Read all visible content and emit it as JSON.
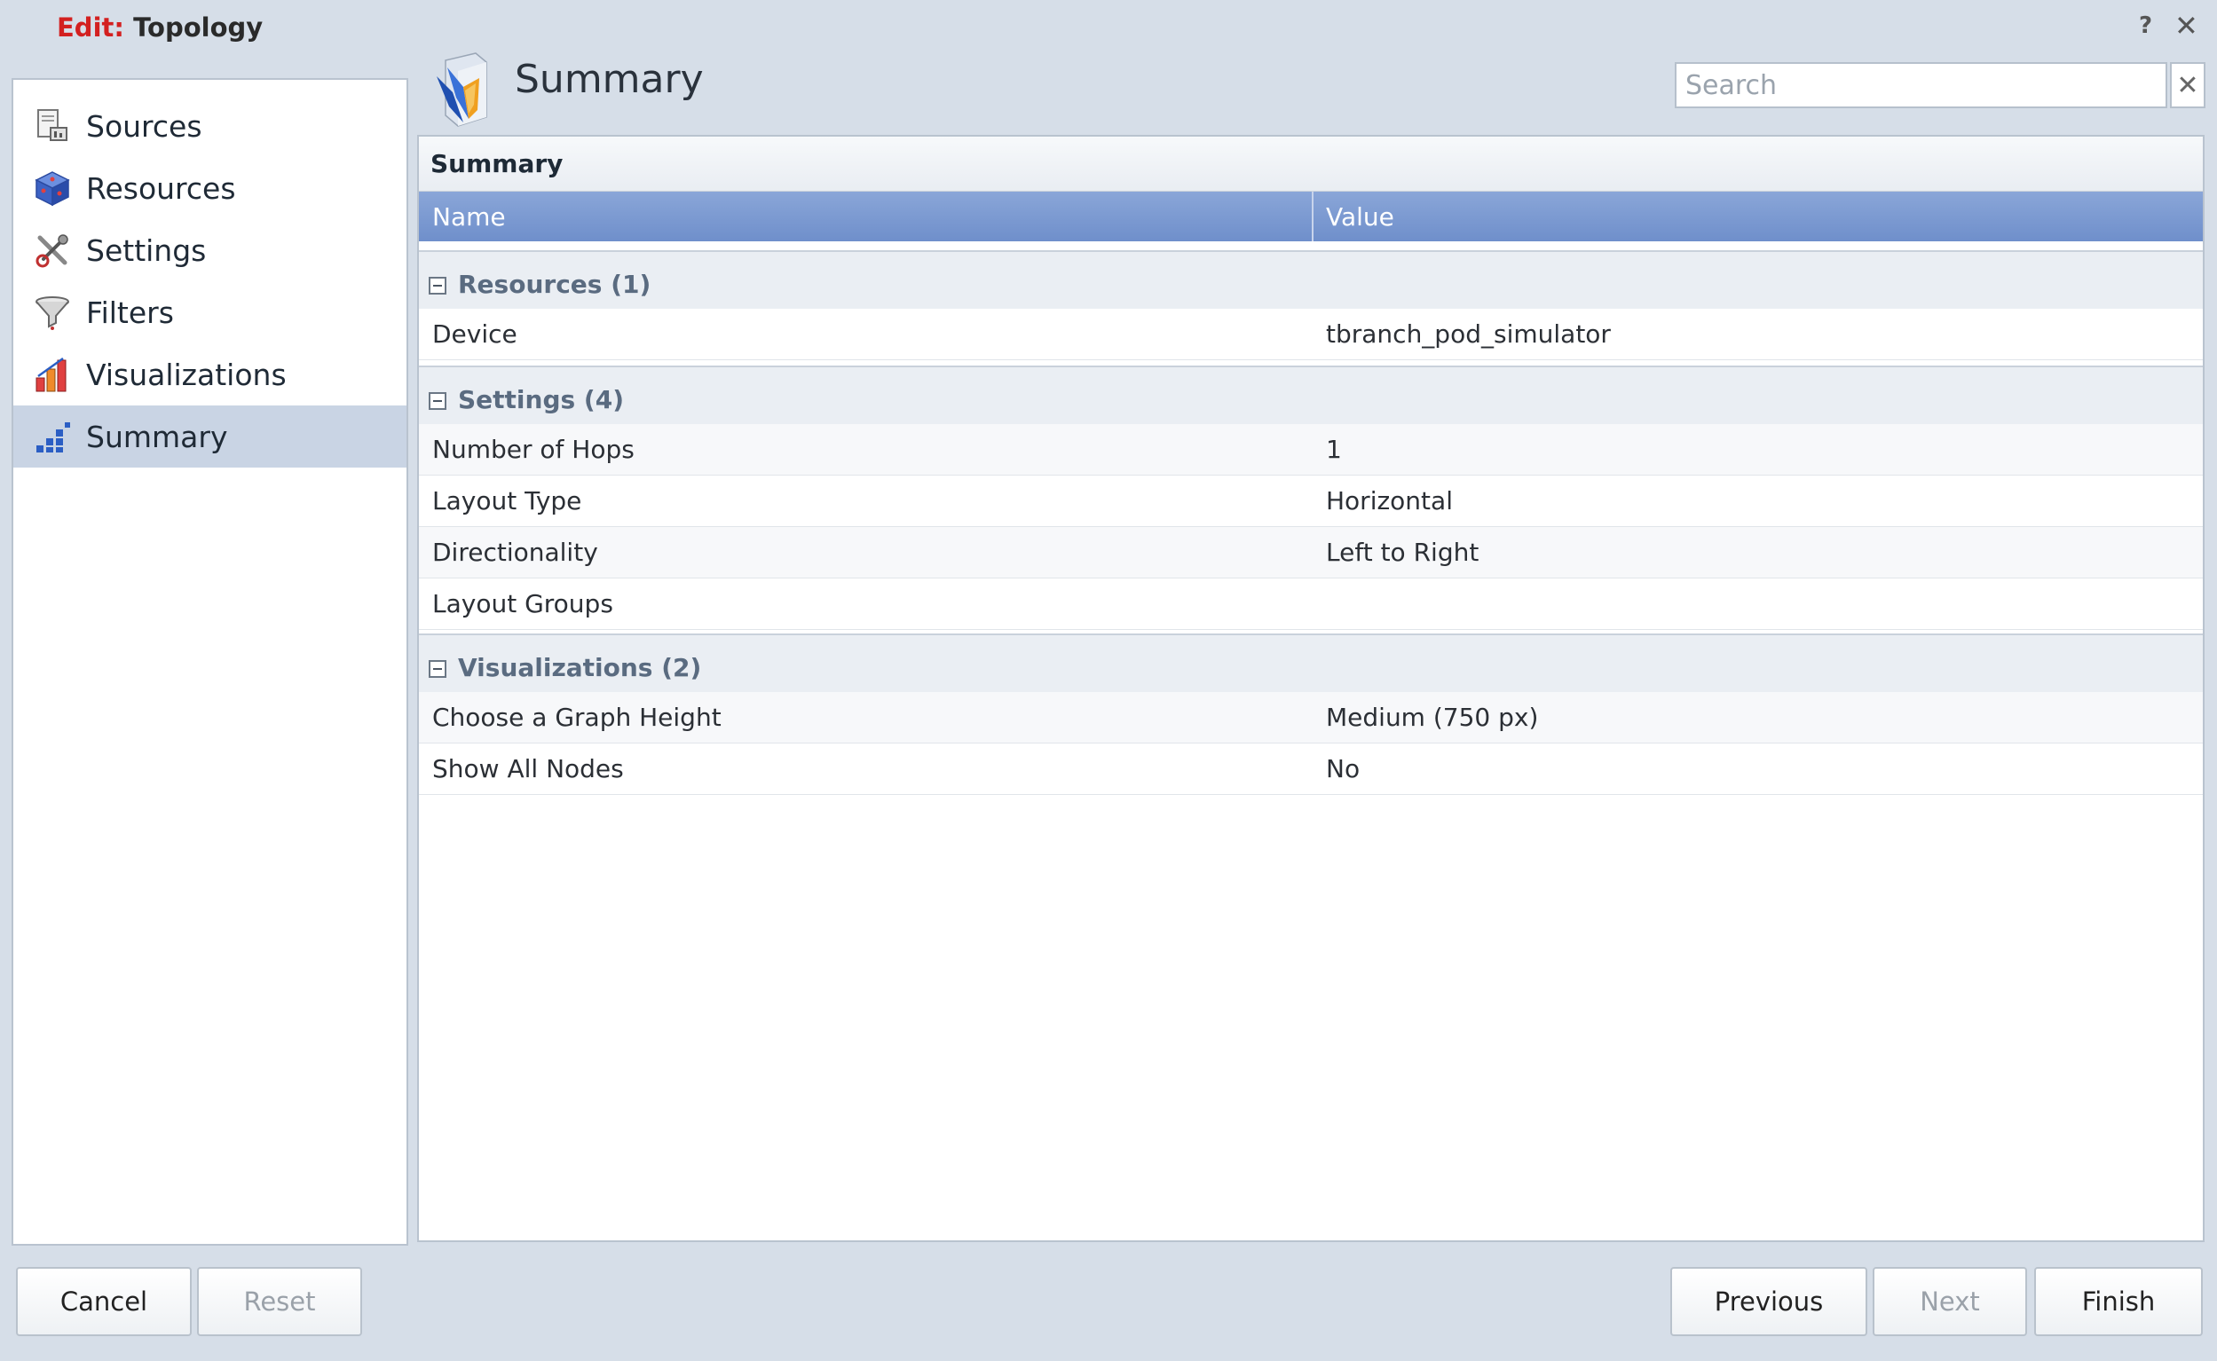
{
  "window": {
    "title_prefix": "Edit:",
    "title_name": "Topology",
    "help_label": "?",
    "close_label": "✕"
  },
  "sidebar": {
    "items": [
      {
        "label": "Sources",
        "icon": "sources-icon",
        "active": false
      },
      {
        "label": "Resources",
        "icon": "resources-cube-icon",
        "active": false
      },
      {
        "label": "Settings",
        "icon": "settings-tools-icon",
        "active": false
      },
      {
        "label": "Filters",
        "icon": "filter-funnel-icon",
        "active": false
      },
      {
        "label": "Visualizations",
        "icon": "bar-chart-icon",
        "active": false
      },
      {
        "label": "Summary",
        "icon": "summary-chart-icon",
        "active": true
      }
    ]
  },
  "header": {
    "title": "Summary",
    "icon": "summary-logo-icon",
    "search_placeholder": "Search",
    "search_value": "",
    "search_clear_label": "✕"
  },
  "panel": {
    "title": "Summary",
    "columns": {
      "name": "Name",
      "value": "Value"
    },
    "groups": [
      {
        "label": "Resources (1)",
        "rows": [
          {
            "name": "Device",
            "value": "tbranch_pod_simulator"
          }
        ]
      },
      {
        "label": "Settings (4)",
        "rows": [
          {
            "name": "Number of Hops",
            "value": "1"
          },
          {
            "name": "Layout Type",
            "value": "Horizontal"
          },
          {
            "name": "Directionality",
            "value": "Left to Right"
          },
          {
            "name": "Layout Groups",
            "value": ""
          }
        ]
      },
      {
        "label": "Visualizations (2)",
        "rows": [
          {
            "name": "Choose a Graph Height",
            "value": "Medium (750 px)"
          },
          {
            "name": "Show All Nodes",
            "value": "No"
          }
        ]
      }
    ]
  },
  "footer": {
    "cancel": "Cancel",
    "reset": "Reset",
    "previous": "Previous",
    "next": "Next",
    "finish": "Finish"
  },
  "colors": {
    "accent_header": "#7896cf",
    "title_edit": "#d32020",
    "active_nav": "#c9d4e4",
    "window_bg": "#d6dee8"
  }
}
